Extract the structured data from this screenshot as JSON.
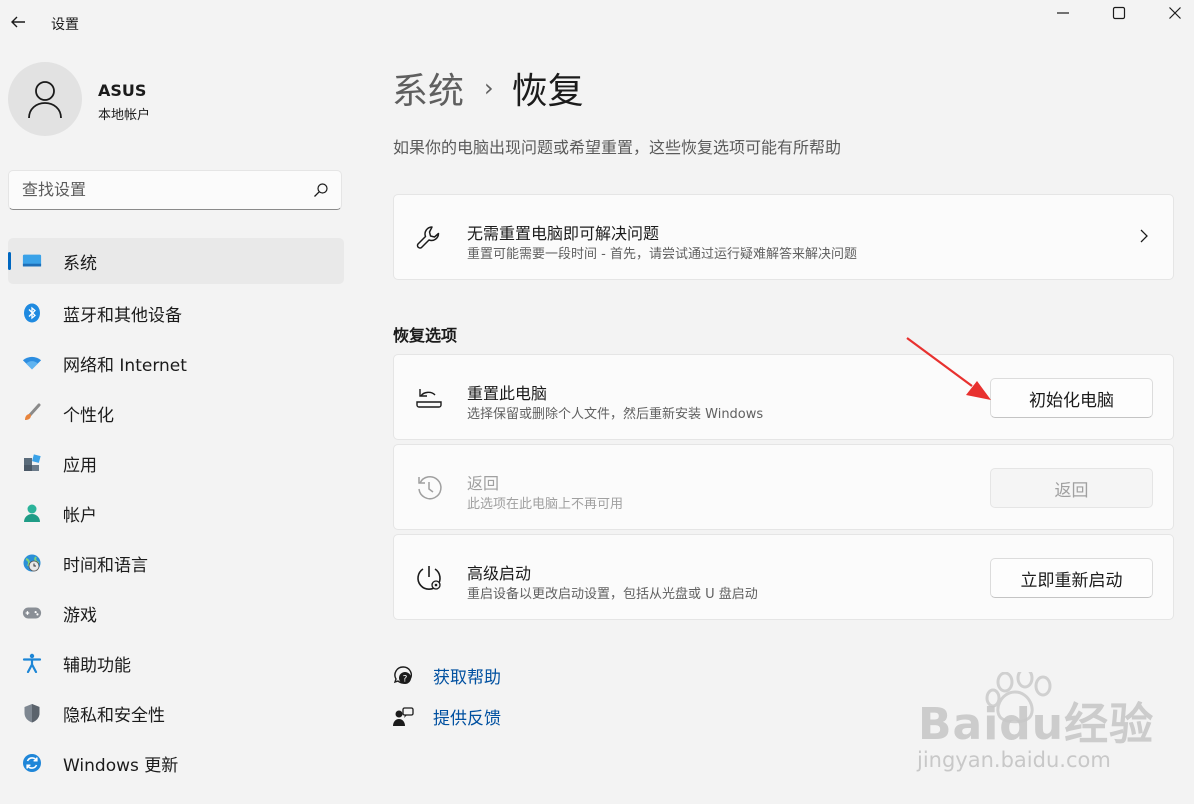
{
  "window": {
    "app_title": "设置",
    "back_icon": "arrow-left-icon",
    "controls": [
      "minimize-icon",
      "maximize-icon",
      "close-icon"
    ]
  },
  "user": {
    "name": "ASUS",
    "account_type": "本地帐户"
  },
  "search": {
    "placeholder": "查找设置"
  },
  "sidebar": {
    "items": [
      {
        "label": "系统",
        "icon": "display-icon",
        "active": true
      },
      {
        "label": "蓝牙和其他设备",
        "icon": "bluetooth-icon"
      },
      {
        "label": "网络和 Internet",
        "icon": "wifi-icon"
      },
      {
        "label": "个性化",
        "icon": "brush-icon"
      },
      {
        "label": "应用",
        "icon": "apps-icon"
      },
      {
        "label": "帐户",
        "icon": "person-icon"
      },
      {
        "label": "时间和语言",
        "icon": "globe-clock-icon"
      },
      {
        "label": "游戏",
        "icon": "gamepad-icon"
      },
      {
        "label": "辅助功能",
        "icon": "accessibility-icon"
      },
      {
        "label": "隐私和安全性",
        "icon": "shield-icon"
      },
      {
        "label": "Windows 更新",
        "icon": "update-icon"
      }
    ]
  },
  "main": {
    "breadcrumb_parent": "系统",
    "breadcrumb_separator": "›",
    "breadcrumb_current": "恢复",
    "subtitle": "如果你的电脑出现问题或希望重置，这些恢复选项可能有所帮助",
    "troubleshoot_card": {
      "title": "无需重置电脑即可解决问题",
      "description": "重置可能需要一段时间 - 首先，请尝试通过运行疑难解答来解决问题"
    },
    "section_title": "恢复选项",
    "options": [
      {
        "title": "重置此电脑",
        "description": "选择保留或删除个人文件，然后重新安装 Windows",
        "button": "初始化电脑",
        "enabled": true
      },
      {
        "title": "返回",
        "description": "此选项在此电脑上不再可用",
        "button": "返回",
        "enabled": false
      },
      {
        "title": "高级启动",
        "description": "重启设备以更改启动设置，包括从光盘或 U 盘启动",
        "button": "立即重新启动",
        "enabled": true
      }
    ],
    "links": [
      {
        "label": "获取帮助",
        "icon": "help-chat-icon"
      },
      {
        "label": "提供反馈",
        "icon": "feedback-icon"
      }
    ]
  },
  "watermark": {
    "brand": "Baidu经验",
    "url": "jingyan.baidu.com"
  },
  "colors": {
    "accent": "#0067c0",
    "link": "#0050a0",
    "annotation_arrow": "#e8312f"
  }
}
